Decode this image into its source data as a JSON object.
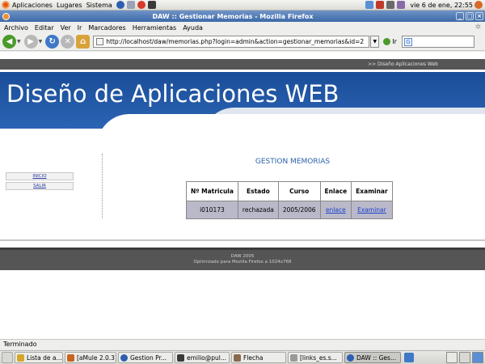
{
  "top_panel": {
    "menus": [
      "Aplicaciones",
      "Lugares",
      "Sistema"
    ],
    "clock": "vie 6 de ene, 22:55"
  },
  "window": {
    "title": "DAW :: Gestionar Memorias - Mozilla Firefox"
  },
  "menu_bar": {
    "items": [
      "Archivo",
      "Editar",
      "Ver",
      "Ir",
      "Marcadores",
      "Herramientas",
      "Ayuda"
    ]
  },
  "toolbar": {
    "url": "http://localhost/daw/memorias.php?login=admin&action=gestionar_memorias&id=2",
    "go_label": "Ir",
    "search_value": ""
  },
  "page": {
    "top_strip_text": ">> Diseño Aplicaciones Web",
    "site_title": "Diseño de Aplicaciones WEB",
    "sidebar": {
      "links": [
        "INICIO",
        "SALIR"
      ]
    },
    "heading": "GESTION MEMORIAS",
    "table": {
      "headers": [
        "Nº Matricula",
        "Estado",
        "Curso",
        "Enlace",
        "Examinar"
      ],
      "rows": [
        {
          "matricula": "i010173",
          "estado": "rechazada",
          "curso": "2005/2006",
          "enlace": "enlace",
          "examinar": "Examinar"
        }
      ]
    },
    "footer": {
      "line1": "DAW 2005",
      "line2": "Optimizado para Mozilla Firefox a 1024x768"
    }
  },
  "status_bar": {
    "text": "Terminado"
  },
  "taskbar": {
    "tasks": [
      "Lista de a...",
      "[aMule 2.0.3]",
      "Gestion Pr...",
      "emilio@pul...",
      "Flecha",
      "[links_es.s...",
      "DAW :: Ges..."
    ]
  },
  "colors": {
    "banner_blue": "#1a4d98",
    "heading_blue": "#2c61a8",
    "table_row": "#b9b9ca",
    "link_blue": "#1f42c8",
    "dark_strip": "#555555"
  }
}
